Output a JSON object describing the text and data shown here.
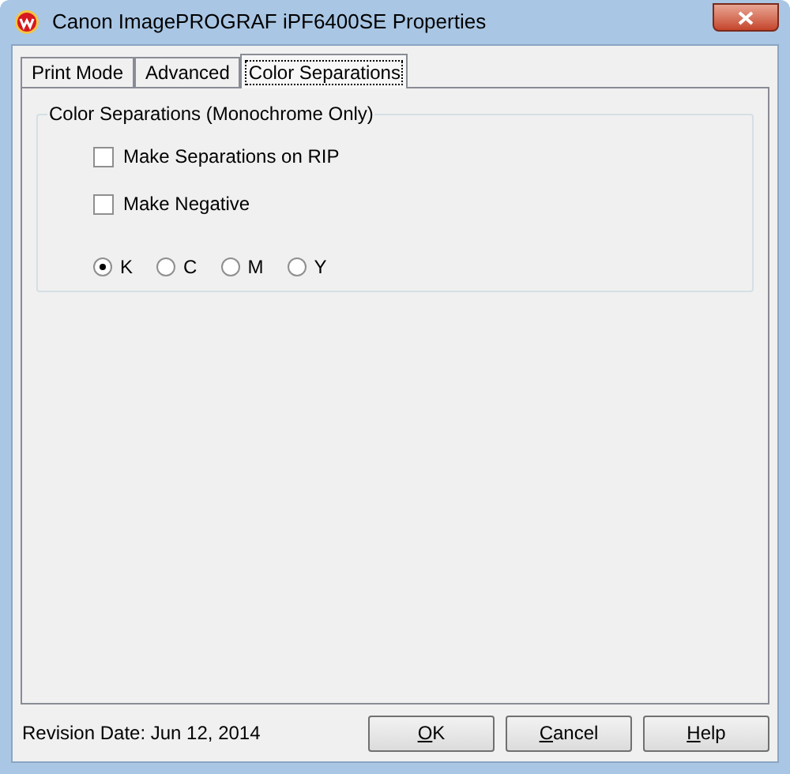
{
  "window": {
    "title": "Canon ImagePROGRAF iPF6400SE Properties"
  },
  "tabs": [
    {
      "label": "Print Mode",
      "selected": false
    },
    {
      "label": "Advanced",
      "selected": false
    },
    {
      "label": "Color Separations",
      "selected": true
    }
  ],
  "group": {
    "title": "Color Separations (Monochrome Only)",
    "checkboxes": [
      {
        "label": "Make Separations on RIP",
        "checked": false
      },
      {
        "label": "Make Negative",
        "checked": false
      }
    ],
    "radios": [
      {
        "label": "K",
        "selected": true
      },
      {
        "label": "C",
        "selected": false
      },
      {
        "label": "M",
        "selected": false
      },
      {
        "label": "Y",
        "selected": false
      }
    ]
  },
  "status": "Revision Date: Jun 12, 2014",
  "buttons": [
    {
      "label": "OK",
      "underline_first": true
    },
    {
      "label": "Cancel",
      "underline_first": true
    },
    {
      "label": "Help",
      "underline_first": true
    }
  ]
}
